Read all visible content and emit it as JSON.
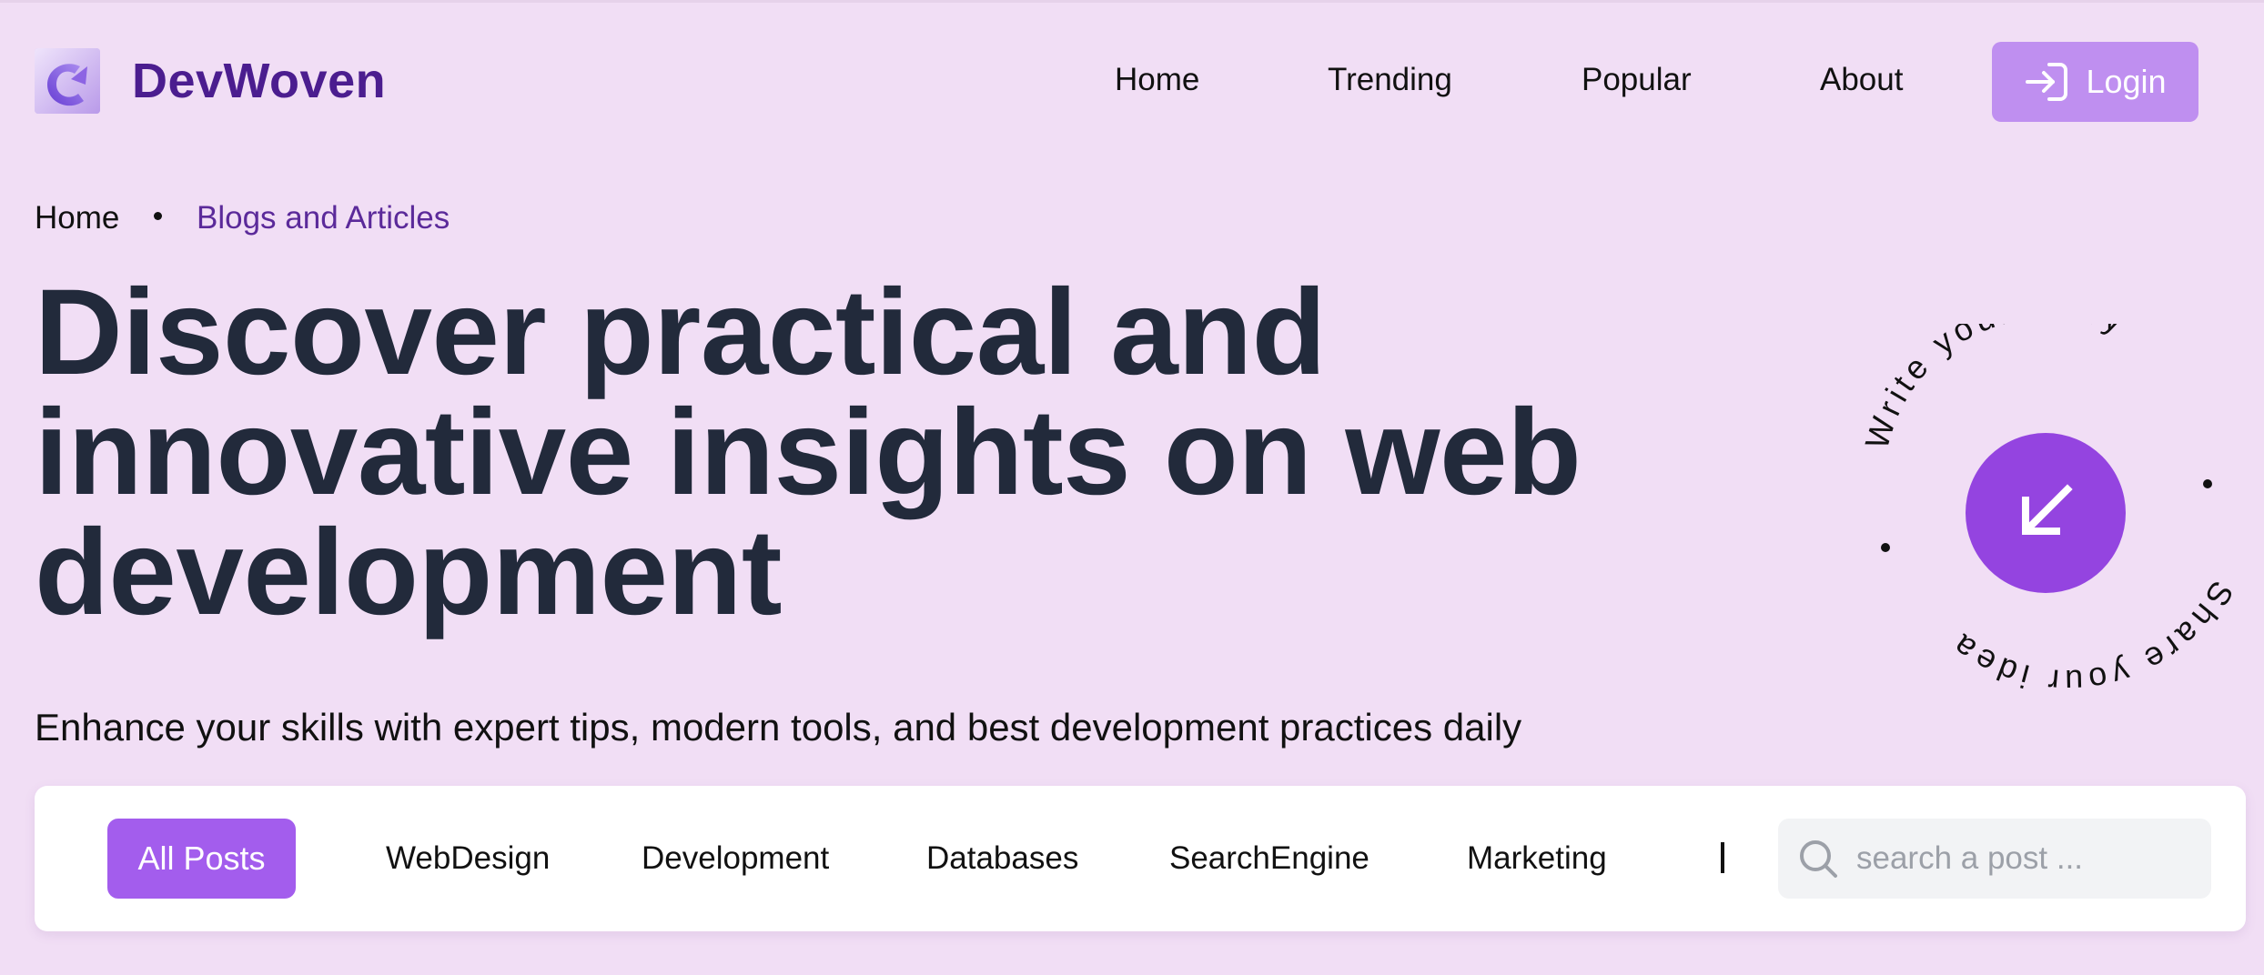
{
  "brand": {
    "name": "DevWoven"
  },
  "nav": {
    "items": [
      {
        "label": "Home"
      },
      {
        "label": "Trending"
      },
      {
        "label": "Popular"
      },
      {
        "label": "About"
      }
    ],
    "login_label": "Login"
  },
  "breadcrumb": {
    "home": "Home",
    "current": "Blogs and Articles"
  },
  "hero": {
    "title": "Discover practical and innovative insights on web development",
    "subtitle": "Enhance your skills with expert tips, modern tools, and best development practices daily"
  },
  "badge": {
    "top_text": "Write your story",
    "bottom_text": "Share your idea",
    "icon": "arrow-down-left-icon"
  },
  "filters": {
    "active_label": "All Posts",
    "items": [
      {
        "label": "WebDesign"
      },
      {
        "label": "Development"
      },
      {
        "label": "Databases"
      },
      {
        "label": "SearchEngine"
      },
      {
        "label": "Marketing"
      }
    ]
  },
  "search": {
    "placeholder": "search a post ...",
    "value": ""
  },
  "colors": {
    "background": "#f1def5",
    "brand": "#4b1d8f",
    "accent": "#a35ded",
    "login_button": "#bf8ff0",
    "badge_circle": "#9444e0",
    "title_text": "#222a3b"
  }
}
